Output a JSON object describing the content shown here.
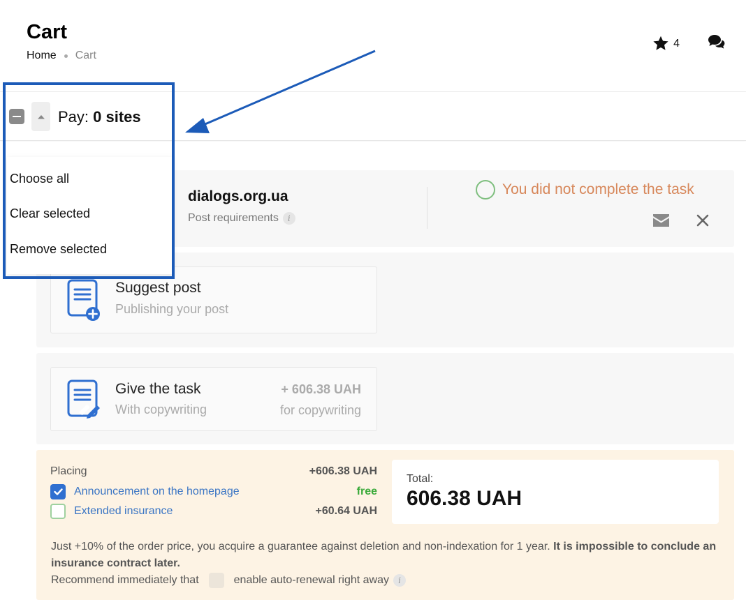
{
  "header": {
    "title": "Cart",
    "breadcrumb": {
      "home": "Home",
      "current": "Cart"
    },
    "favorites_count": "4",
    "icons": {
      "favorites": "star-icon",
      "chat": "chat-bubbles-icon"
    }
  },
  "paybar": {
    "label_prefix": "Pay:",
    "label_count": "0 sites",
    "icons": {
      "select": "minus-checkbox-icon",
      "toggle": "caret-up-icon"
    }
  },
  "dropdown": {
    "items": [
      "Choose all",
      "Clear selected",
      "Remove selected"
    ]
  },
  "site": {
    "name": "dialogs.org.ua",
    "requirements_label": "Post requirements",
    "info_glyph": "i",
    "status_text": "You did not complete the task",
    "icons": {
      "status": "circle-icon",
      "message": "envelope-icon",
      "remove": "close-icon"
    }
  },
  "options": {
    "suggest": {
      "title": "Suggest post",
      "subtitle": "Publishing your post",
      "icon": "document-plus-icon"
    },
    "task": {
      "title": "Give the task",
      "subtitle": "With copywriting",
      "price": "+ 606.38 UAH",
      "price_note": "for copywriting",
      "icon": "document-pen-icon"
    }
  },
  "summary": {
    "placing_label": "Placing",
    "placing_value": "+606.38 UAH",
    "announcement_label": "Announcement on the homepage",
    "announcement_value": "free",
    "announcement_checked": true,
    "insurance_label": "Extended insurance",
    "insurance_value": "+60.64 UAH",
    "insurance_checked": false,
    "total_label": "Total:",
    "total_value": "606.38 UAH",
    "insurance_note": "Just +10% of the order price, you acquire a guarantee against deletion and non-indexation for 1 year.",
    "insurance_note_bold": "It is impossible to conclude an insurance contract later.",
    "recommend_prefix": "Recommend immediately that",
    "recommend_suffix": "enable auto-renewal right away",
    "recommend_info": "i"
  },
  "colors": {
    "accent": "#2f6fd0",
    "highlight": "#1c5bb8",
    "status_warning": "#d7875a",
    "free": "#3aaa3a",
    "summary_bg": "#fdf3e4"
  }
}
